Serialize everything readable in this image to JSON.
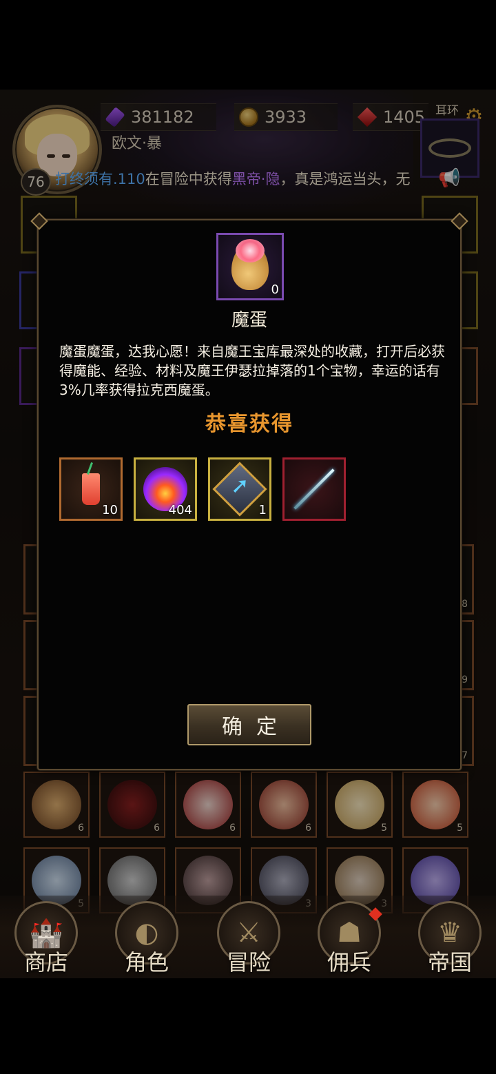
{
  "hud": {
    "level": "76",
    "player_name": "欧文·暴",
    "resources": {
      "energy": "381182",
      "gold": "3933",
      "gems": "1405"
    },
    "earring_label": "耳环",
    "ticker_prefix": "打终须有.110",
    "ticker_mid": "在冒险中获得",
    "ticker_item": "黑帝·隐",
    "ticker_suffix": "，真是鸿运当头，无"
  },
  "dialog": {
    "item_name": "魔蛋",
    "item_count": "0",
    "description": "魔蛋魔蛋，达我心愿！来自魔王宝库最深处的收藏，打开后必获得魔能、经验、材料及魔王伊瑟拉掉落的1个宝物，幸运的话有3%几率获得拉克西魔蛋。",
    "congrats": "恭喜获得",
    "rewards": [
      {
        "icon": "cocktail-icon",
        "count": "10",
        "rarity": "orange"
      },
      {
        "icon": "flame-orb-icon",
        "count": "404",
        "rarity": "gold"
      },
      {
        "icon": "upgrade-scroll-icon",
        "count": "1",
        "rarity": "gold"
      },
      {
        "icon": "sword-icon",
        "count": "",
        "rarity": "red"
      }
    ],
    "confirm_label": "确定"
  },
  "heroes_row1": [
    "6",
    "6",
    "6",
    "6",
    "5",
    "5"
  ],
  "heroes_row2": [
    "5",
    "",
    "",
    "3",
    "3",
    ""
  ],
  "side_counts": [
    "8",
    "9",
    "7"
  ],
  "nav": [
    {
      "label": "商店",
      "icon": "castle-icon"
    },
    {
      "label": "角色",
      "icon": "hood-icon"
    },
    {
      "label": "冒险",
      "icon": "crossed-swords-icon"
    },
    {
      "label": "佣兵",
      "icon": "mercenary-icon"
    },
    {
      "label": "帝国",
      "icon": "crown-icon"
    }
  ],
  "colors": {
    "accent": "#e8962e",
    "ticker_blue": "#5fb0ff",
    "ticker_purple": "#c07aff"
  }
}
